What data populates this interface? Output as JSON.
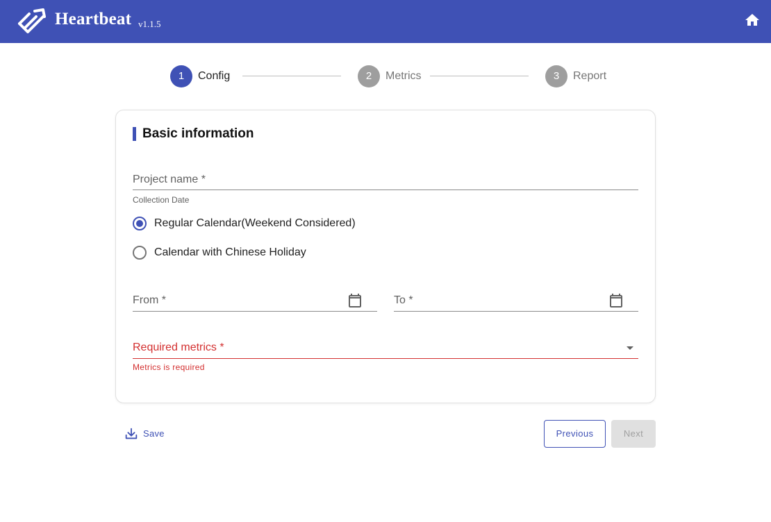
{
  "header": {
    "app_name": "Heartbeat",
    "version": "v1.1.5",
    "logo_icon": "heartbeat-logo-icon",
    "home_icon": "home-icon",
    "background_color": "#3f51b5"
  },
  "stepper": {
    "active_step": 1,
    "steps": [
      {
        "number": "1",
        "label": "Config",
        "state": "active"
      },
      {
        "number": "2",
        "label": "Metrics",
        "state": "inactive"
      },
      {
        "number": "3",
        "label": "Report",
        "state": "inactive"
      }
    ]
  },
  "basic_info": {
    "title": "Basic information",
    "project_name": {
      "label": "Project name *",
      "value": ""
    },
    "collection_date": {
      "label": "Collection Date",
      "options": [
        {
          "label": "Regular Calendar(Weekend Considered)",
          "checked": true
        },
        {
          "label": "Calendar with Chinese Holiday",
          "checked": false
        }
      ]
    },
    "from_date": {
      "label": "From *",
      "value": "",
      "icon": "calendar-icon"
    },
    "to_date": {
      "label": "To *",
      "value": "",
      "icon": "calendar-icon"
    },
    "required_metrics": {
      "label": "Required metrics *",
      "value": "",
      "icon": "dropdown-arrow-icon",
      "error": "Metrics is required"
    }
  },
  "actions": {
    "save_label": "Save",
    "save_icon": "download-icon",
    "previous_label": "Previous",
    "next_label": "Next",
    "next_disabled": true
  },
  "colors": {
    "primary": "#3f51b5",
    "error": "#d32f2f",
    "inactive_step": "#9e9e9e"
  }
}
